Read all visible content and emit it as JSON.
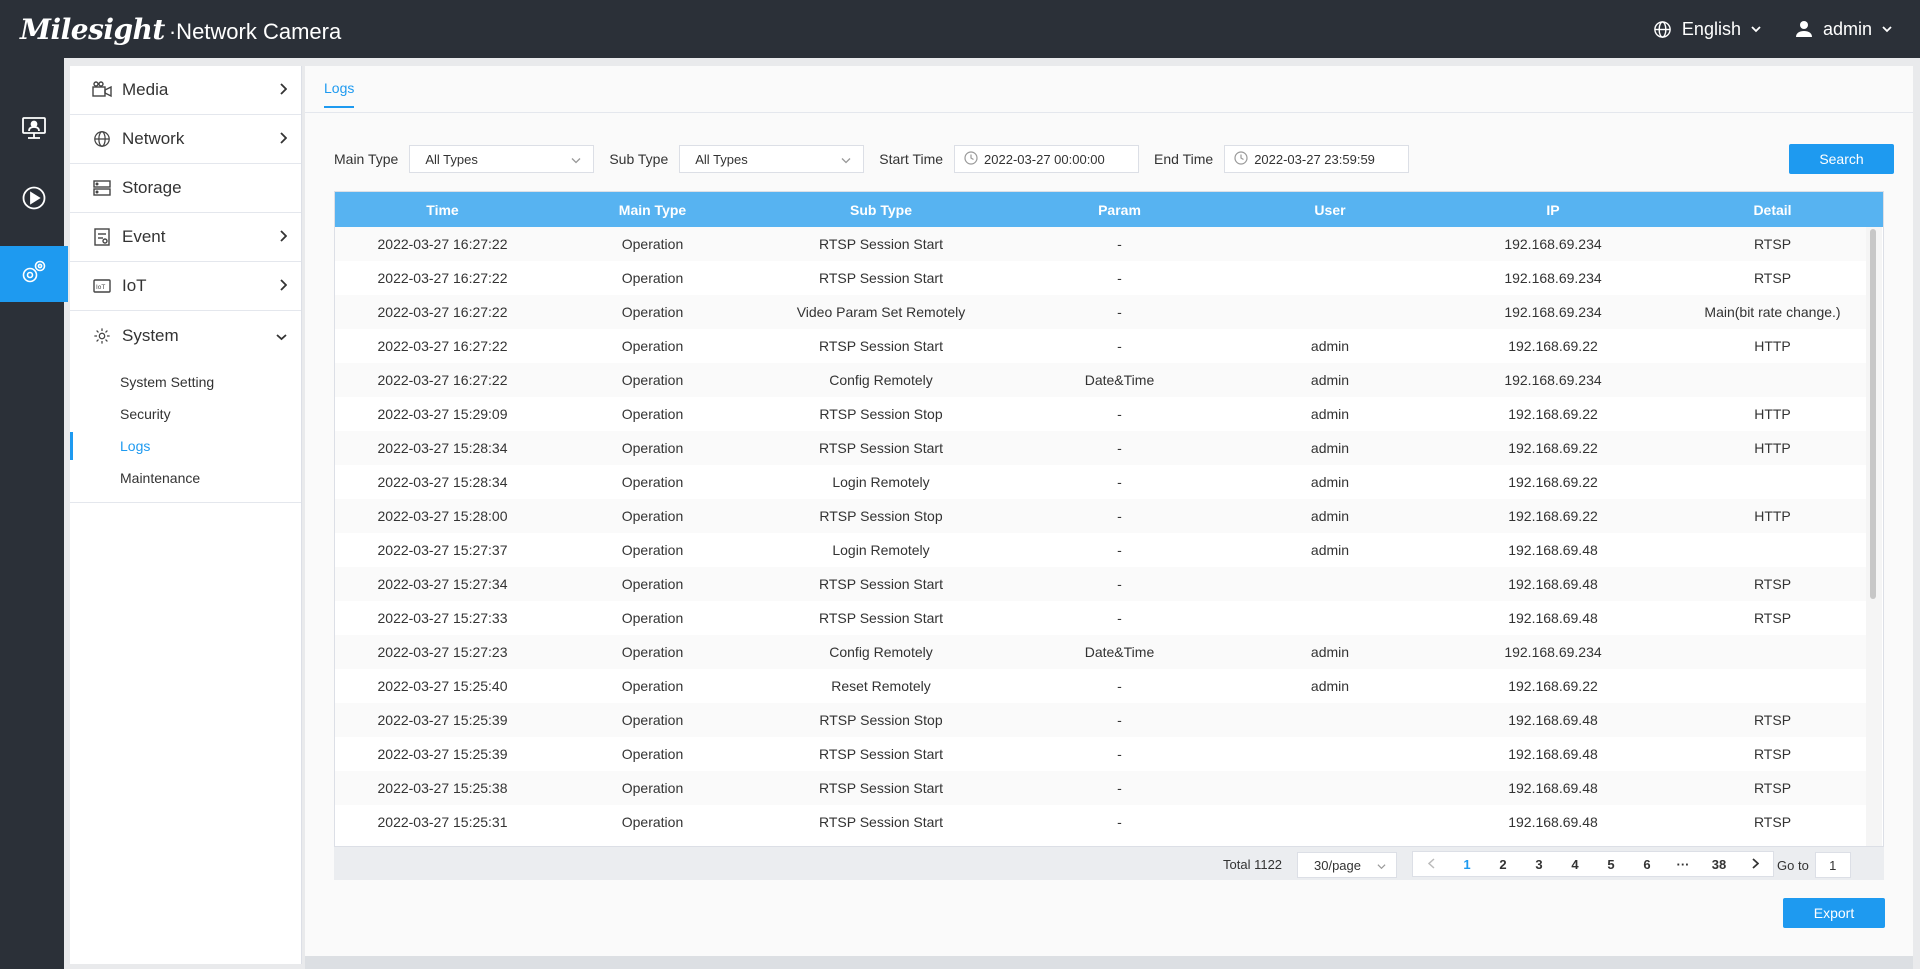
{
  "header": {
    "brand": "Milesight",
    "product": "·Network Camera",
    "language": "English",
    "user": "admin"
  },
  "rail": {
    "items": [
      "live-view-icon",
      "playback-icon",
      "settings-icon"
    ],
    "active_index": 2
  },
  "sidebar": {
    "items": [
      {
        "label": "Media",
        "icon": "camera-icon"
      },
      {
        "label": "Network",
        "icon": "globe-icon"
      },
      {
        "label": "Storage",
        "icon": "storage-icon"
      },
      {
        "label": "Event",
        "icon": "event-icon"
      },
      {
        "label": "IoT",
        "icon": "iot-icon"
      },
      {
        "label": "System",
        "icon": "gear-icon"
      }
    ],
    "system_sub": [
      "System Setting",
      "Security",
      "Logs",
      "Maintenance"
    ],
    "active_sub": "Logs"
  },
  "tabs": [
    "Logs"
  ],
  "filters": {
    "main_type_label": "Main Type",
    "main_type_value": "All Types",
    "sub_type_label": "Sub Type",
    "sub_type_value": "All Types",
    "start_time_label": "Start Time",
    "start_time_value": "2022-03-27 00:00:00",
    "end_time_label": "End Time",
    "end_time_value": "2022-03-27 23:59:59",
    "search_label": "Search"
  },
  "table": {
    "columns": [
      "Time",
      "Main Type",
      "Sub Type",
      "Param",
      "User",
      "IP",
      "Detail"
    ],
    "rows": [
      [
        "2022-03-27 16:27:22",
        "Operation",
        "RTSP Session Start",
        "-",
        "",
        "192.168.69.234",
        "RTSP"
      ],
      [
        "2022-03-27 16:27:22",
        "Operation",
        "RTSP Session Start",
        "-",
        "",
        "192.168.69.234",
        "RTSP"
      ],
      [
        "2022-03-27 16:27:22",
        "Operation",
        "Video Param Set Remotely",
        "-",
        "",
        "192.168.69.234",
        "Main(bit rate change.)"
      ],
      [
        "2022-03-27 16:27:22",
        "Operation",
        "RTSP Session Start",
        "-",
        "admin",
        "192.168.69.22",
        "HTTP"
      ],
      [
        "2022-03-27 16:27:22",
        "Operation",
        "Config Remotely",
        "Date&Time",
        "admin",
        "192.168.69.234",
        ""
      ],
      [
        "2022-03-27 15:29:09",
        "Operation",
        "RTSP Session Stop",
        "-",
        "admin",
        "192.168.69.22",
        "HTTP"
      ],
      [
        "2022-03-27 15:28:34",
        "Operation",
        "RTSP Session Start",
        "-",
        "admin",
        "192.168.69.22",
        "HTTP"
      ],
      [
        "2022-03-27 15:28:34",
        "Operation",
        "Login Remotely",
        "-",
        "admin",
        "192.168.69.22",
        ""
      ],
      [
        "2022-03-27 15:28:00",
        "Operation",
        "RTSP Session Stop",
        "-",
        "admin",
        "192.168.69.22",
        "HTTP"
      ],
      [
        "2022-03-27 15:27:37",
        "Operation",
        "Login Remotely",
        "-",
        "admin",
        "192.168.69.48",
        ""
      ],
      [
        "2022-03-27 15:27:34",
        "Operation",
        "RTSP Session Start",
        "-",
        "",
        "192.168.69.48",
        "RTSP"
      ],
      [
        "2022-03-27 15:27:33",
        "Operation",
        "RTSP Session Start",
        "-",
        "",
        "192.168.69.48",
        "RTSP"
      ],
      [
        "2022-03-27 15:27:23",
        "Operation",
        "Config Remotely",
        "Date&Time",
        "admin",
        "192.168.69.234",
        ""
      ],
      [
        "2022-03-27 15:25:40",
        "Operation",
        "Reset Remotely",
        "-",
        "admin",
        "192.168.69.22",
        ""
      ],
      [
        "2022-03-27 15:25:39",
        "Operation",
        "RTSP Session Stop",
        "-",
        "",
        "192.168.69.48",
        "RTSP"
      ],
      [
        "2022-03-27 15:25:39",
        "Operation",
        "RTSP Session Start",
        "-",
        "",
        "192.168.69.48",
        "RTSP"
      ],
      [
        "2022-03-27 15:25:38",
        "Operation",
        "RTSP Session Start",
        "-",
        "",
        "192.168.69.48",
        "RTSP"
      ],
      [
        "2022-03-27 15:25:31",
        "Operation",
        "RTSP Session Start",
        "-",
        "",
        "192.168.69.48",
        "RTSP"
      ]
    ]
  },
  "pagination": {
    "total": "Total 1122",
    "page_size": "30/page",
    "pages": [
      "1",
      "2",
      "3",
      "4",
      "5",
      "6",
      "···",
      "38"
    ],
    "current": "1",
    "goto_label": "Go to",
    "goto_value": "1"
  },
  "export_label": "Export",
  "colors": {
    "accent": "#1e9af0",
    "header_bg": "#2b3038",
    "table_header": "#57b3f1"
  }
}
